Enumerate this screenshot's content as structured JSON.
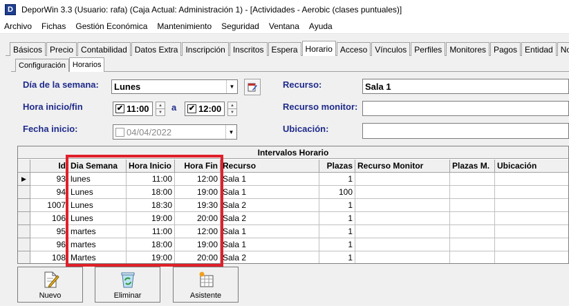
{
  "window": {
    "app_icon_letter": "D",
    "title": "DeporWin 3.3  (Usuario: rafa)  (Caja Actual: Administración 1) - [Actividades - Aerobic (clases puntuales)]"
  },
  "menu": [
    {
      "label": "Archivo"
    },
    {
      "label": "Fichas"
    },
    {
      "label": "Gestión Económica"
    },
    {
      "label": "Mantenimiento"
    },
    {
      "label": "Seguridad"
    },
    {
      "label": "Ventana"
    },
    {
      "label": "Ayuda"
    }
  ],
  "tabs": [
    {
      "label": "Básicos"
    },
    {
      "label": "Precio"
    },
    {
      "label": "Contabilidad"
    },
    {
      "label": "Datos Extra"
    },
    {
      "label": "Inscripción"
    },
    {
      "label": "Inscritos"
    },
    {
      "label": "Espera"
    },
    {
      "label": "Horario"
    },
    {
      "label": "Acceso"
    },
    {
      "label": "Vínculos"
    },
    {
      "label": "Perfiles"
    },
    {
      "label": "Monitores"
    },
    {
      "label": "Pagos"
    },
    {
      "label": "Entidad"
    },
    {
      "label": "Notas"
    }
  ],
  "active_tab": "Horario",
  "subtabs": [
    {
      "label": "Configuración"
    },
    {
      "label": "Horarios"
    }
  ],
  "form": {
    "dia_label": "Día de la semana:",
    "dia_value": "Lunes",
    "hora_label": "Hora inicio/fin",
    "hora_inicio": "11:00",
    "hora_sep": "a",
    "hora_fin": "12:00",
    "fecha_label": "Fecha inicio:",
    "fecha_value": "04/04/2022",
    "recurso_label": "Recurso:",
    "recurso_value": "Sala 1",
    "monitor_label": "Recurso monitor:",
    "monitor_value": "",
    "ubicacion_label": "Ubicación:",
    "ubicacion_value": ""
  },
  "grid": {
    "caption": "Intervalos Horario",
    "columns": [
      "Id",
      "Dia Semana",
      "Hora Inicio",
      "Hora Fin",
      "Recurso",
      "Plazas",
      "Recurso Monitor",
      "Plazas M.",
      "Ubicación"
    ],
    "rows": [
      [
        "93",
        "lunes",
        "11:00",
        "12:00",
        "Sala 1",
        "1",
        "",
        "",
        ""
      ],
      [
        "94",
        "Lunes",
        "18:00",
        "19:00",
        "Sala 1",
        "100",
        "",
        "",
        ""
      ],
      [
        "1007",
        "Lunes",
        "18:30",
        "19:30",
        "Sala 2",
        "1",
        "",
        "",
        ""
      ],
      [
        "106",
        "Lunes",
        "19:00",
        "20:00",
        "Sala 2",
        "1",
        "",
        "",
        ""
      ],
      [
        "95",
        "martes",
        "11:00",
        "12:00",
        "Sala 1",
        "1",
        "",
        "",
        ""
      ],
      [
        "96",
        "martes",
        "18:00",
        "19:00",
        "Sala 1",
        "1",
        "",
        "",
        ""
      ],
      [
        "108",
        "Martes",
        "19:00",
        "20:00",
        "Sala 2",
        "1",
        "",
        "",
        ""
      ]
    ]
  },
  "buttons": {
    "nuevo": "Nuevo",
    "eliminar": "Eliminar",
    "asistente": "Asistente"
  },
  "colors": {
    "label": "#1e2a8a",
    "highlight": "#e0202a"
  }
}
